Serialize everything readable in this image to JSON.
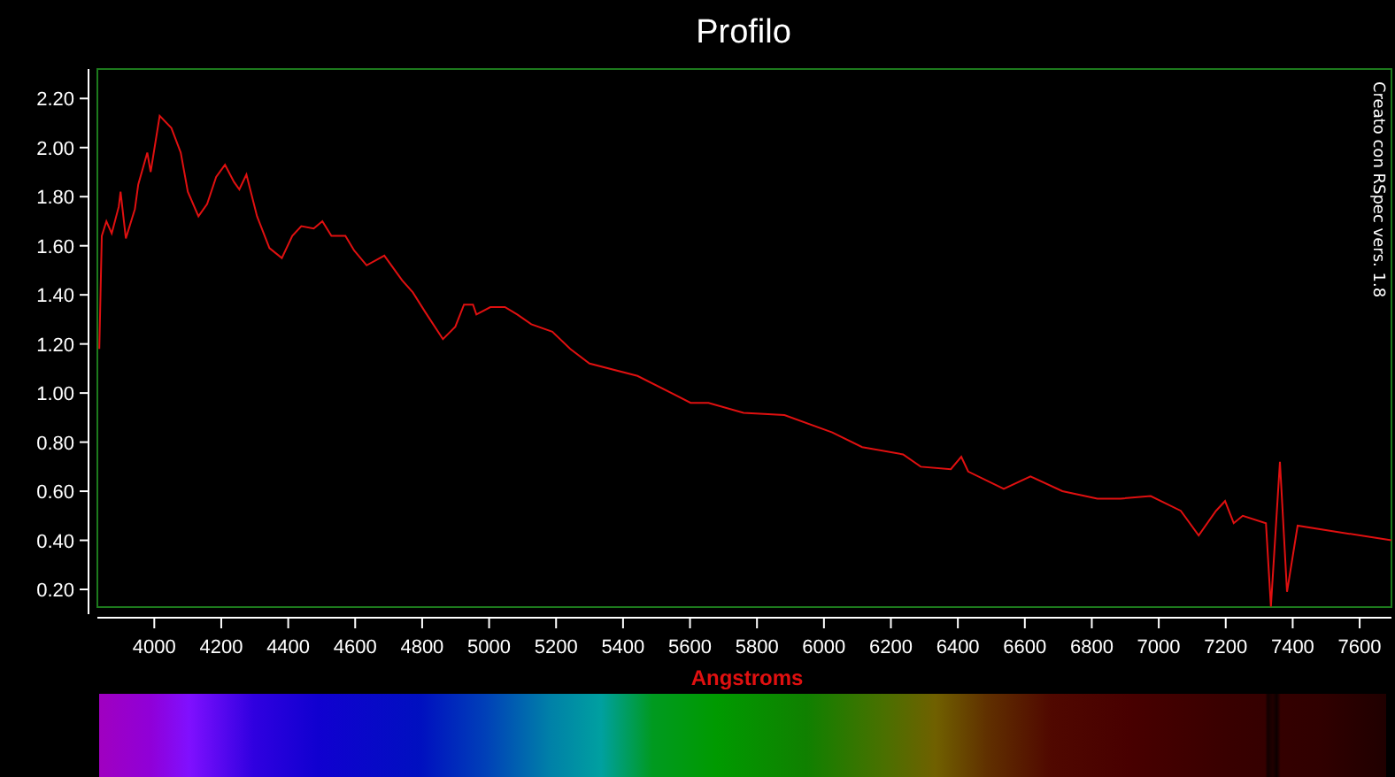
{
  "chart": {
    "chart_data": {
      "type": "line",
      "title": "Profilo",
      "xlabel": "Angstroms",
      "x": [
        3836,
        3843,
        3857,
        3873,
        3894,
        3899,
        3915,
        3942,
        3952,
        3979,
        3989,
        4016,
        4051,
        4079,
        4100,
        4132,
        4158,
        4185,
        4211,
        4238,
        4254,
        4275,
        4307,
        4344,
        4381,
        4412,
        4439,
        4476,
        4502,
        4529,
        4571,
        4597,
        4634,
        4687,
        4740,
        4772,
        4809,
        4862,
        4899,
        4925,
        4952,
        4962,
        5004,
        5047,
        5084,
        5126,
        5189,
        5242,
        5300,
        5443,
        5602,
        5655,
        5760,
        5882,
        6025,
        6114,
        6236,
        6289,
        6379,
        6410,
        6431,
        6537,
        6617,
        6712,
        6817,
        6886,
        6976,
        7066,
        7119,
        7171,
        7198,
        7224,
        7251,
        7320,
        7335,
        7362,
        7383,
        7415,
        7695
      ],
      "series": [
        {
          "color": "#e01010",
          "values": [
            1.18,
            1.64,
            1.7,
            1.65,
            1.76,
            1.82,
            1.63,
            1.75,
            1.85,
            1.98,
            1.9,
            2.13,
            2.08,
            1.98,
            1.82,
            1.72,
            1.77,
            1.88,
            1.93,
            1.86,
            1.83,
            1.89,
            1.72,
            1.59,
            1.55,
            1.64,
            1.68,
            1.67,
            1.7,
            1.64,
            1.64,
            1.58,
            1.52,
            1.56,
            1.46,
            1.41,
            1.33,
            1.22,
            1.27,
            1.36,
            1.36,
            1.32,
            1.35,
            1.35,
            1.32,
            1.28,
            1.25,
            1.18,
            1.12,
            1.07,
            0.96,
            0.96,
            0.92,
            0.91,
            0.84,
            0.78,
            0.75,
            0.7,
            0.69,
            0.74,
            0.68,
            0.61,
            0.66,
            0.6,
            0.57,
            0.57,
            0.58,
            0.52,
            0.42,
            0.52,
            0.56,
            0.47,
            0.5,
            0.47,
            0.13,
            0.72,
            0.19,
            0.46,
            0.4
          ]
        }
      ],
      "xlim": [
        3830,
        7695
      ],
      "ylim": [
        0.128,
        2.32
      ],
      "xticks": [
        4000,
        4200,
        4400,
        4600,
        4800,
        5000,
        5200,
        5400,
        5600,
        5800,
        6000,
        6200,
        6400,
        6600,
        6800,
        7000,
        7200,
        7400,
        7600
      ],
      "yticks": [
        {
          "value": 0.2,
          "label": "0.20"
        },
        {
          "value": 0.4,
          "label": "0.40"
        },
        {
          "value": 0.6,
          "label": "0.60"
        },
        {
          "value": 0.8,
          "label": "0.80"
        },
        {
          "value": 1.0,
          "label": "1.00"
        },
        {
          "value": 1.2,
          "label": "1.20"
        },
        {
          "value": 1.4,
          "label": "1.40"
        },
        {
          "value": 1.6,
          "label": "1.60"
        },
        {
          "value": 1.8,
          "label": "1.80"
        },
        {
          "value": 2.0,
          "label": "2.00"
        },
        {
          "value": 2.2,
          "label": "2.20"
        }
      ],
      "annotations": [
        {
          "text": "Creato con RSpec vers. 1.8"
        }
      ]
    }
  }
}
